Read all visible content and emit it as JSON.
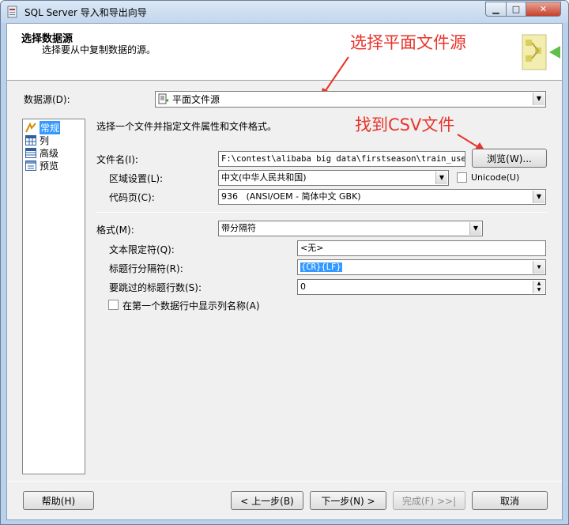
{
  "window": {
    "title": "SQL Server 导入和导出向导",
    "min_glyph": "▁",
    "max_glyph": "□",
    "close_glyph": "✕"
  },
  "header": {
    "title": "选择数据源",
    "subtitle": "选择要从中复制数据的源。"
  },
  "annotations": {
    "note1": "选择平面文件源",
    "note2": "找到CSV文件"
  },
  "datasource": {
    "label": "数据源(D):",
    "value": "平面文件源"
  },
  "nav": {
    "items": [
      {
        "label": "常规",
        "icon": "general-icon",
        "selected": true
      },
      {
        "label": "列",
        "icon": "columns-icon",
        "selected": false
      },
      {
        "label": "高级",
        "icon": "advanced-icon",
        "selected": false
      },
      {
        "label": "预览",
        "icon": "preview-icon",
        "selected": false
      }
    ]
  },
  "general": {
    "instruction": "选择一个文件并指定文件属性和文件格式。",
    "filename_label": "文件名(I):",
    "filename_value": "F:\\contest\\alibaba big data\\firstseason\\train_user\\",
    "browse_label": "浏览(W)...",
    "locale_label": "区域设置(L):",
    "locale_value": "中文(中华人民共和国)",
    "unicode_label": "Unicode(U)",
    "codepage_label": "代码页(C):",
    "codepage_value": "936   (ANSI/OEM - 简体中文 GBK)",
    "format_label": "格式(M):",
    "format_value": "带分隔符",
    "text_qualifier_label": "文本限定符(Q):",
    "text_qualifier_value": "<无>",
    "header_row_delim_label": "标题行分隔符(R):",
    "header_row_delim_value": "{CR}{LF}",
    "header_rows_skip_label": "要跳过的标题行数(S):",
    "header_rows_skip_value": "0",
    "first_row_names_label": "在第一个数据行中显示列名称(A)"
  },
  "footer": {
    "help": "帮助(H)",
    "back": "< 上一步(B)",
    "next": "下一步(N) >",
    "finish": "完成(F) >>|",
    "cancel": "取消"
  },
  "colors": {
    "annotation": "#e8342a",
    "selection": "#3399ff"
  }
}
